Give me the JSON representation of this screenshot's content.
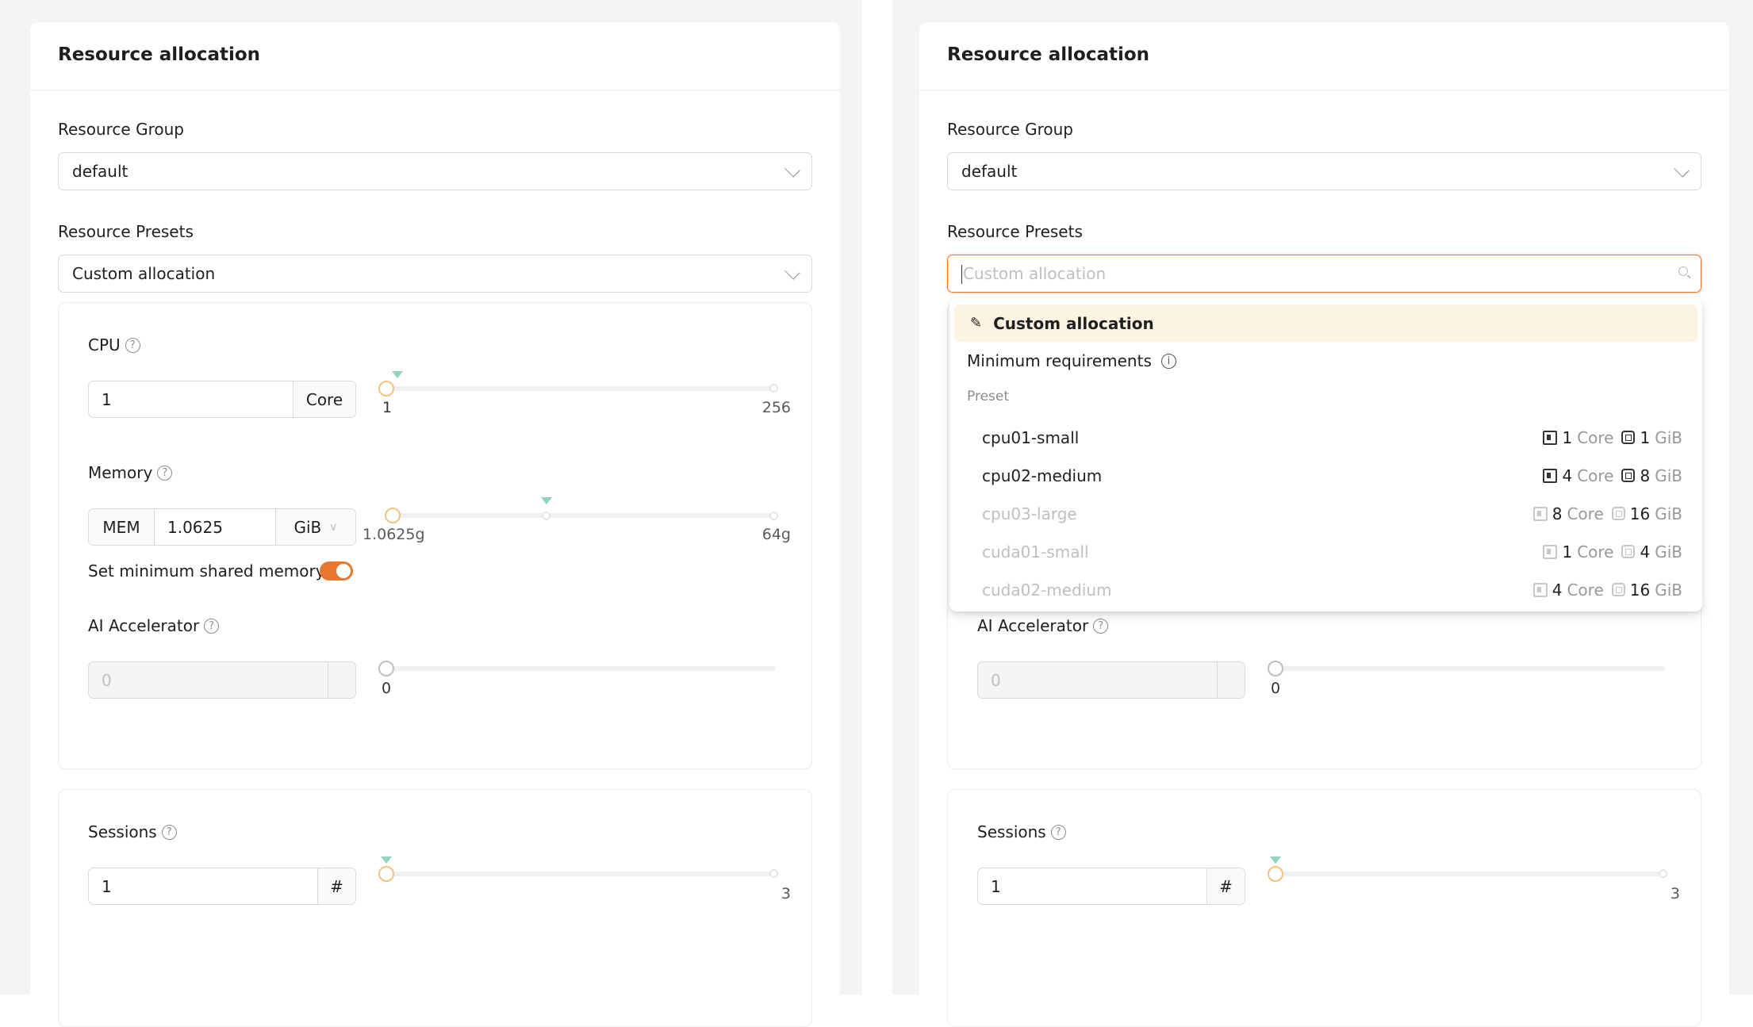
{
  "panel": {
    "title": "Resource allocation",
    "resource_group_label": "Resource Group",
    "resource_group_value": "default",
    "resource_presets_label": "Resource Presets",
    "resource_presets_value": "Custom allocation",
    "cpu": {
      "label": "CPU",
      "value": "1",
      "unit": "Core",
      "min_label": "1",
      "max_label": "256",
      "value_fraction": 0
    },
    "memory": {
      "label": "Memory",
      "prefix": "MEM",
      "value": "1.0625",
      "unit": "GiB",
      "min_label": "1.0625g",
      "max_label": "64g"
    },
    "shm": {
      "label": "Set minimum shared memory",
      "enabled": true
    },
    "accelerator": {
      "label": "AI Accelerator",
      "placeholder": "0",
      "min_label": "0"
    },
    "sessions": {
      "label": "Sessions",
      "value": "1",
      "unit": "#",
      "max_label": "3"
    }
  },
  "dropdown": {
    "custom_label": "Custom allocation",
    "minimum_label": "Minimum requirements",
    "group_label": "Preset",
    "core_unit": "Core",
    "mem_unit": "GiB",
    "presets": [
      {
        "name": "cpu01-small",
        "cpu": "1",
        "mem": "1",
        "enabled": true
      },
      {
        "name": "cpu02-medium",
        "cpu": "4",
        "mem": "8",
        "enabled": true
      },
      {
        "name": "cpu03-large",
        "cpu": "8",
        "mem": "16",
        "enabled": false
      },
      {
        "name": "cuda01-small",
        "cpu": "1",
        "mem": "4",
        "enabled": false
      },
      {
        "name": "cuda02-medium",
        "cpu": "4",
        "mem": "16",
        "enabled": false
      }
    ]
  },
  "colors": {
    "accent": "#e8762c",
    "handle": "#f3c27c",
    "marker": "#8fd3c0"
  }
}
